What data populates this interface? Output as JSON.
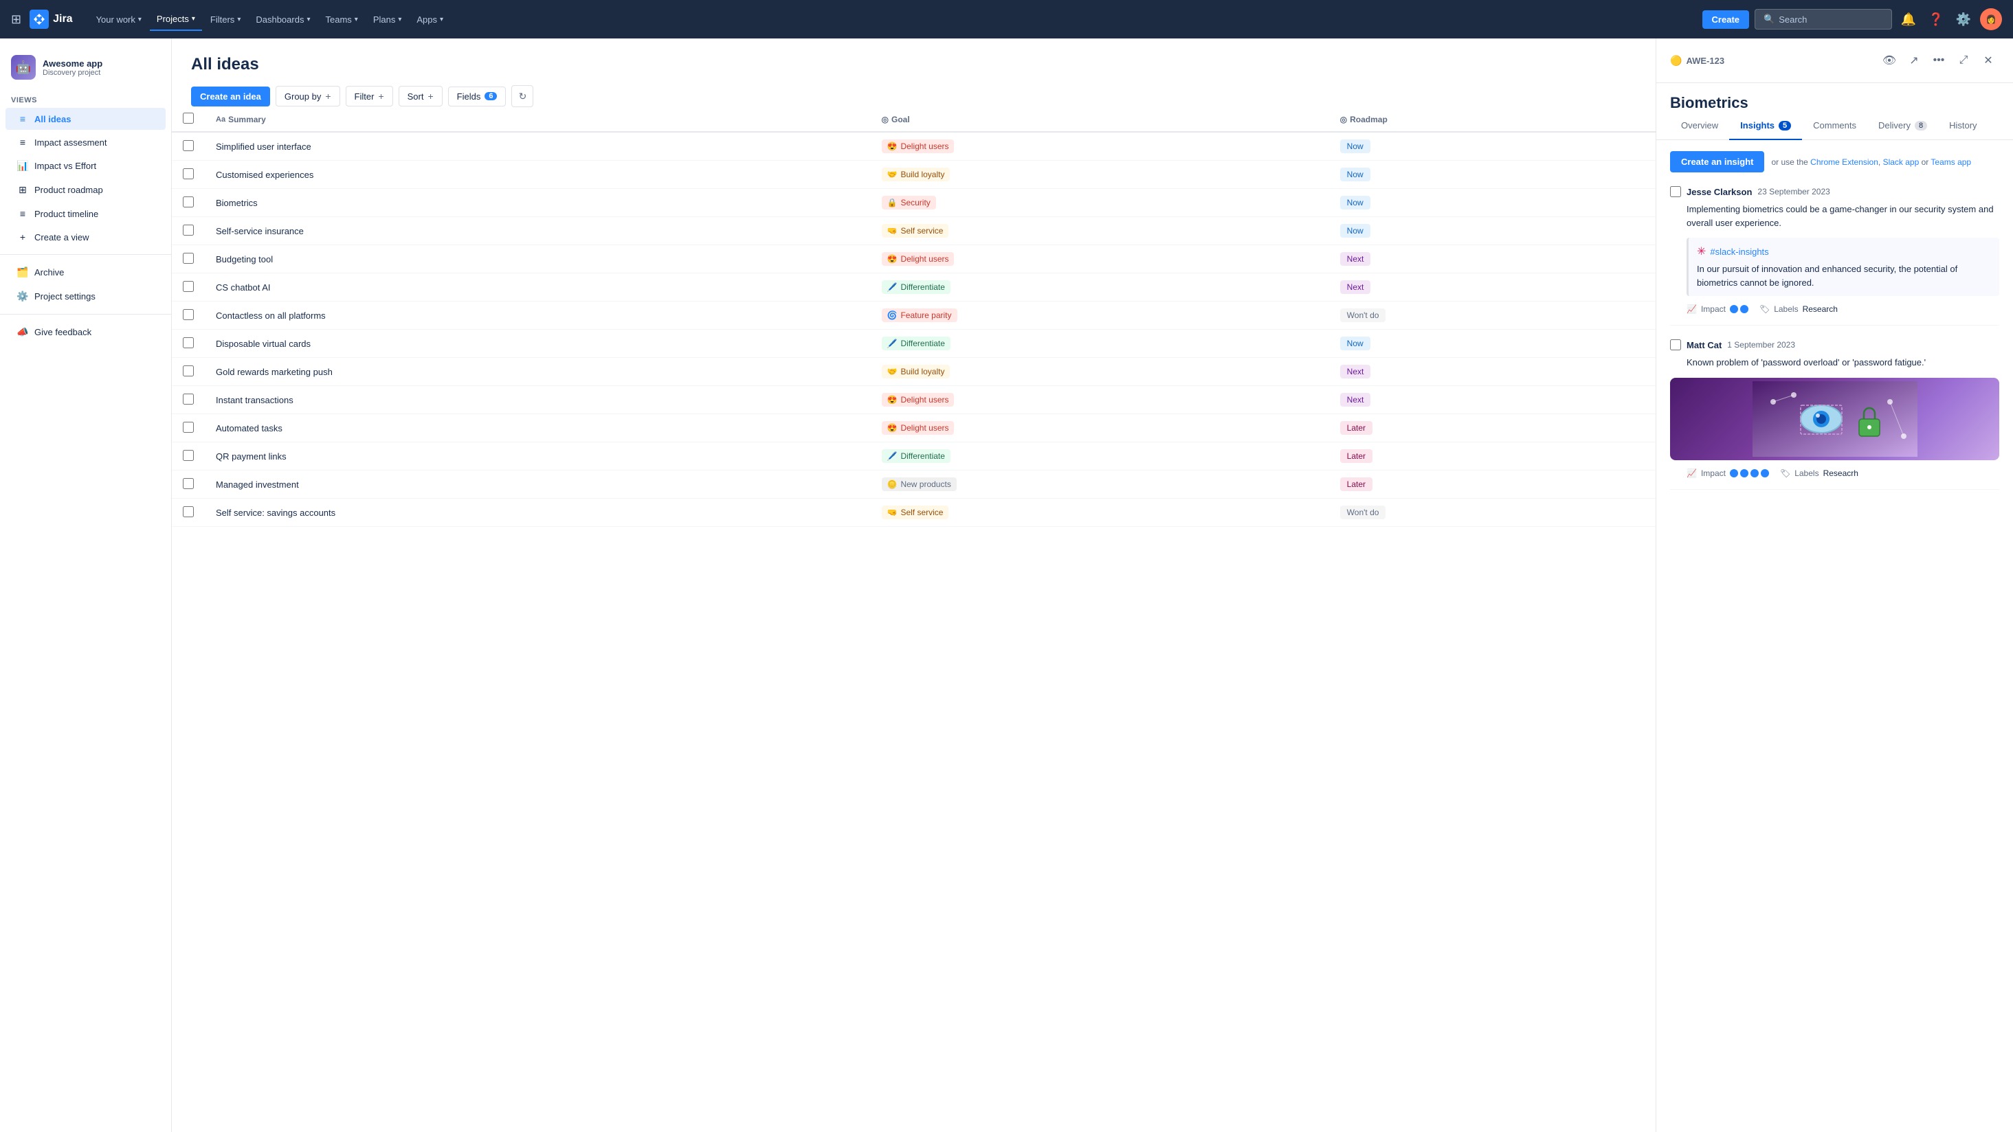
{
  "topnav": {
    "logo_text": "Jira",
    "nav_items": [
      {
        "label": "Your work",
        "dropdown": true,
        "active": false
      },
      {
        "label": "Projects",
        "dropdown": true,
        "active": true
      },
      {
        "label": "Filters",
        "dropdown": true,
        "active": false
      },
      {
        "label": "Dashboards",
        "dropdown": true,
        "active": false
      },
      {
        "label": "Teams",
        "dropdown": true,
        "active": false
      },
      {
        "label": "Plans",
        "dropdown": true,
        "active": false
      },
      {
        "label": "Apps",
        "dropdown": true,
        "active": false
      }
    ],
    "create_label": "Create",
    "search_placeholder": "Search"
  },
  "sidebar": {
    "project_name": "Awesome app",
    "project_type": "Discovery project",
    "views_label": "VIEWS",
    "views": [
      {
        "label": "All ideas",
        "icon": "≡",
        "active": true
      },
      {
        "label": "Impact assesment",
        "icon": "≡",
        "active": false
      },
      {
        "label": "Impact vs Effort",
        "icon": "📊",
        "active": false
      },
      {
        "label": "Product roadmap",
        "icon": "⊞",
        "active": false
      },
      {
        "label": "Product timeline",
        "icon": "≡",
        "active": false
      }
    ],
    "create_view_label": "Create a view",
    "archive_label": "Archive",
    "project_settings_label": "Project settings",
    "feedback_label": "Give feedback"
  },
  "main": {
    "title": "All ideas",
    "toolbar": {
      "create_idea_label": "Create an idea",
      "group_by_label": "Group by",
      "filter_label": "Filter",
      "sort_label": "Sort",
      "fields_label": "Fields",
      "fields_count": "6"
    },
    "table": {
      "columns": [
        "Summary",
        "Goal",
        "Roadmap"
      ],
      "rows": [
        {
          "summary": "Simplified user interface",
          "goal_emoji": "😍",
          "goal_label": "Delight users",
          "goal_class": "goal-delight",
          "roadmap": "Now",
          "roadmap_class": "roadmap-now"
        },
        {
          "summary": "Customised experiences",
          "goal_emoji": "🤝",
          "goal_label": "Build loyalty",
          "goal_class": "goal-loyalty",
          "roadmap": "Now",
          "roadmap_class": "roadmap-now"
        },
        {
          "summary": "Biometrics",
          "goal_emoji": "🔒",
          "goal_label": "Security",
          "goal_class": "goal-security",
          "roadmap": "Now",
          "roadmap_class": "roadmap-now"
        },
        {
          "summary": "Self-service insurance",
          "goal_emoji": "🤜",
          "goal_label": "Self service",
          "goal_class": "goal-selfservice",
          "roadmap": "Now",
          "roadmap_class": "roadmap-now"
        },
        {
          "summary": "Budgeting tool",
          "goal_emoji": "😍",
          "goal_label": "Delight users",
          "goal_class": "goal-delight",
          "roadmap": "Next",
          "roadmap_class": "roadmap-next"
        },
        {
          "summary": "CS chatbot AI",
          "goal_emoji": "🖊️",
          "goal_label": "Differentiate",
          "goal_class": "goal-differentiate",
          "roadmap": "Next",
          "roadmap_class": "roadmap-next"
        },
        {
          "summary": "Contactless on all platforms",
          "goal_emoji": "🌀",
          "goal_label": "Feature parity",
          "goal_class": "goal-featureparity",
          "roadmap": "Won't do",
          "roadmap_class": "roadmap-wontdo"
        },
        {
          "summary": "Disposable virtual cards",
          "goal_emoji": "🖊️",
          "goal_label": "Differentiate",
          "goal_class": "goal-differentiate",
          "roadmap": "Now",
          "roadmap_class": "roadmap-now"
        },
        {
          "summary": "Gold rewards marketing push",
          "goal_emoji": "🤝",
          "goal_label": "Build loyalty",
          "goal_class": "goal-loyalty",
          "roadmap": "Next",
          "roadmap_class": "roadmap-next"
        },
        {
          "summary": "Instant transactions",
          "goal_emoji": "😍",
          "goal_label": "Delight users",
          "goal_class": "goal-delight",
          "roadmap": "Next",
          "roadmap_class": "roadmap-next"
        },
        {
          "summary": "Automated tasks",
          "goal_emoji": "😍",
          "goal_label": "Delight users",
          "goal_class": "goal-delight",
          "roadmap": "Later",
          "roadmap_class": "roadmap-later"
        },
        {
          "summary": "QR payment links",
          "goal_emoji": "🖊️",
          "goal_label": "Differentiate",
          "goal_class": "goal-differentiate",
          "roadmap": "Later",
          "roadmap_class": "roadmap-later"
        },
        {
          "summary": "Managed investment",
          "goal_emoji": "🪙",
          "goal_label": "New products",
          "goal_class": "goal-newproducts",
          "roadmap": "Later",
          "roadmap_class": "roadmap-later"
        },
        {
          "summary": "Self service: savings accounts",
          "goal_emoji": "🤜",
          "goal_label": "Self service",
          "goal_class": "goal-selfservice",
          "roadmap": "Won't do",
          "roadmap_class": "roadmap-wontdo"
        }
      ]
    }
  },
  "detail": {
    "issue_id": "AWE-123",
    "title": "Biometrics",
    "tabs": [
      {
        "label": "Overview",
        "badge": null
      },
      {
        "label": "Insights",
        "badge": "5"
      },
      {
        "label": "Comments",
        "badge": null
      },
      {
        "label": "Delivery",
        "badge": "8"
      },
      {
        "label": "History",
        "badge": null
      }
    ],
    "active_tab": "Insights",
    "create_insight_label": "Create an insight",
    "or_use_text": "or use the",
    "chrome_ext": "Chrome Extension",
    "comma": ",",
    "slack_app": "Slack app",
    "or": "or",
    "teams_app": "Teams app",
    "insights": [
      {
        "author": "Jesse Clarkson",
        "date": "23 September 2023",
        "text": "Implementing biometrics could be a game-changer in our security system and overall user experience.",
        "has_slack": true,
        "slack_channel": "#slack-insights",
        "slack_text": "In our pursuit of innovation and enhanced security, the potential of biometrics cannot be ignored.",
        "impact_dots": 2,
        "labels_value": "Research"
      },
      {
        "author": "Matt Cat",
        "date": "1 September 2023",
        "text": "Known problem of 'password overload' or 'password fatigue.'",
        "has_slack": false,
        "has_image": true,
        "impact_dots": 4,
        "labels_value": "Reseacrh"
      }
    ]
  }
}
